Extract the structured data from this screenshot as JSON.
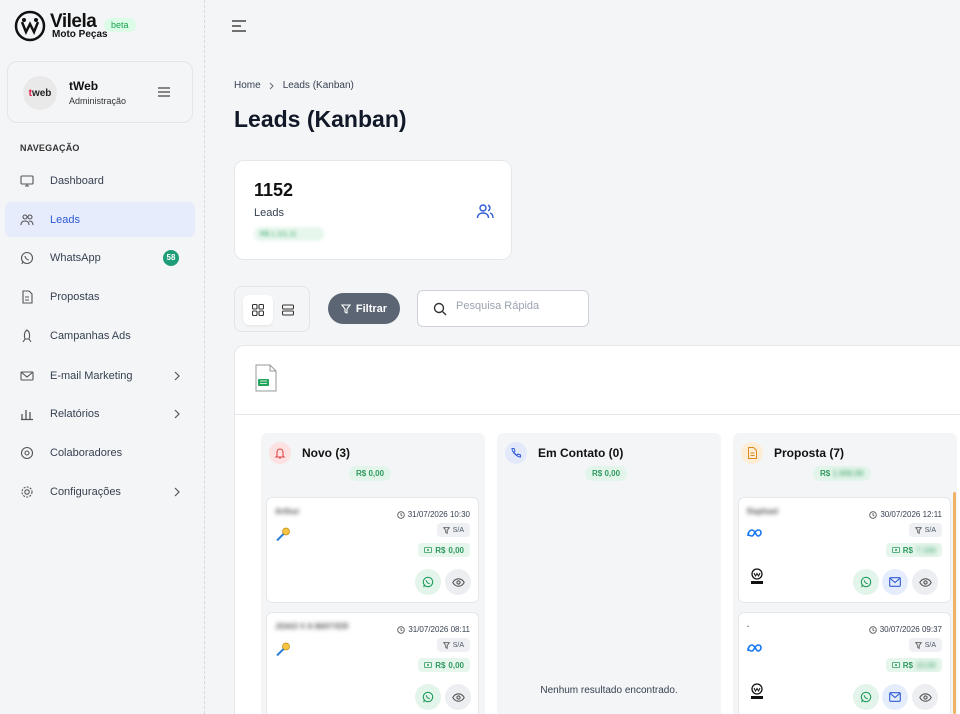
{
  "brand": {
    "name": "Vilela",
    "sub": "Moto Peças",
    "badge": "beta"
  },
  "user": {
    "avatar_text_pre": "t",
    "avatar_text_post": "web",
    "name": "tWeb",
    "role": "Administração"
  },
  "nav": {
    "section_label": "NAVEGAÇÃO",
    "items": [
      {
        "label": "Dashboard"
      },
      {
        "label": "Leads"
      },
      {
        "label": "WhatsApp",
        "badge": "58"
      },
      {
        "label": "Propostas"
      },
      {
        "label": "Campanhas Ads"
      },
      {
        "label": "E-mail Marketing"
      },
      {
        "label": "Relatórios"
      },
      {
        "label": "Colaboradores"
      },
      {
        "label": "Configurações"
      }
    ]
  },
  "breadcrumb": {
    "home": "Home",
    "current": "Leads (Kanban)"
  },
  "page": {
    "title": "Leads (Kanban)"
  },
  "stat": {
    "count": "1152",
    "label": "Leads",
    "value": "R$ 1.111,11"
  },
  "toolbar": {
    "filter_label": "Filtrar",
    "search_placeholder": "Pesquisa Rápida"
  },
  "columns": [
    {
      "title": "Novo (3)",
      "total": "R$ 0,00",
      "cards": [
        {
          "name": "Arthur",
          "date": "31/07/2026 10:30",
          "tag": "S/A",
          "value_prefix": "R$",
          "value": "0,00"
        },
        {
          "name": "JOAO V A MAYYER",
          "date": "31/07/2026 08:11",
          "tag": "S/A",
          "value_prefix": "R$",
          "value": "0,00"
        }
      ]
    },
    {
      "title": "Em Contato (0)",
      "total": "R$ 0,00",
      "empty": "Nenhum resultado encontrado."
    },
    {
      "title": "Proposta (7)",
      "total_prefix": "R$",
      "total": "1.000,00",
      "cards": [
        {
          "name": "Raphael",
          "date": "30/07/2026 12:11",
          "tag": "S/A",
          "value_prefix": "R$",
          "value": "7.100"
        },
        {
          "name": "·",
          "date": "30/07/2026 09:37",
          "tag": "S/A",
          "value_prefix": "R$",
          "value": "10,00"
        }
      ]
    }
  ],
  "colors": {
    "accent": "#2f5bd6",
    "success": "#1f9d78",
    "filter_bg": "#5b6573",
    "scroll_accent": "#f0b366"
  }
}
